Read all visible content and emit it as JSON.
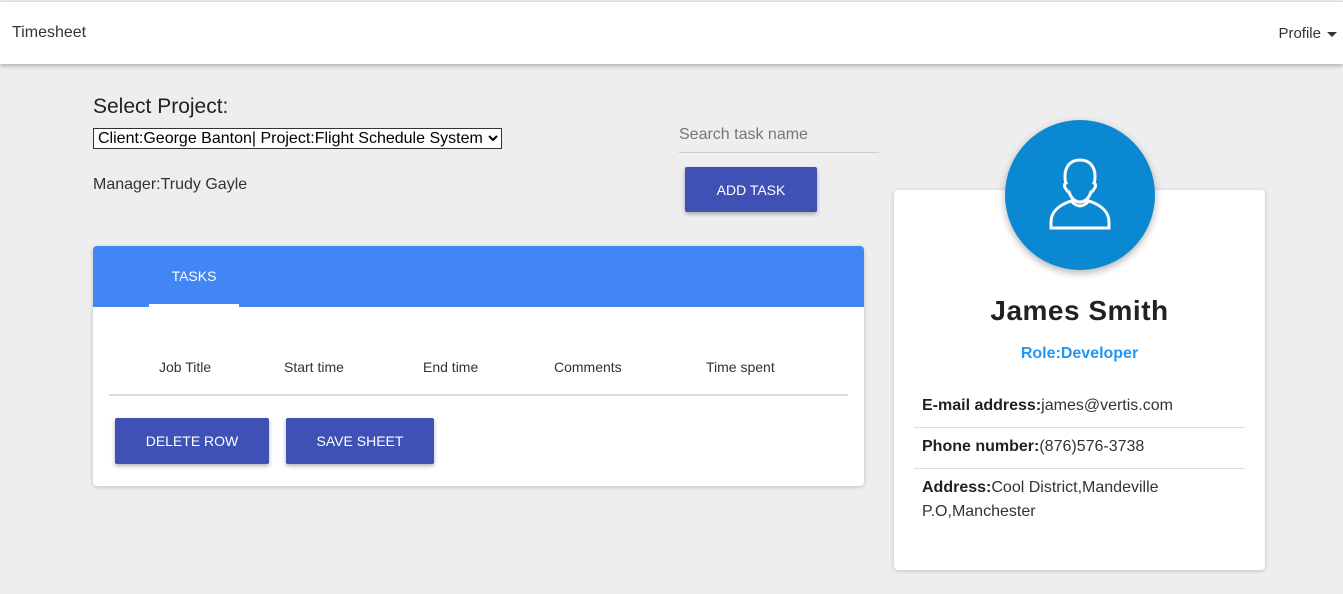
{
  "nav": {
    "brand": "Timesheet",
    "profile": "Profile"
  },
  "project": {
    "label": "Select Project:",
    "selected": "Client:George Banton| Project:Flight Schedule System",
    "manager": "Manager:Trudy Gayle"
  },
  "search": {
    "placeholder": "Search task name",
    "add_task": "ADD TASK"
  },
  "tasks": {
    "tab": "TASKS",
    "columns": [
      "Job Title",
      "Start time",
      "End time",
      "Comments",
      "Time spent"
    ],
    "delete_row": "DELETE ROW",
    "save_sheet": "SAVE SHEET"
  },
  "user": {
    "name": "James Smith",
    "role": "Role:Developer",
    "email_label": "E-mail address:",
    "email": "james@vertis.com",
    "phone_label": "Phone number:",
    "phone": "(876)576-3738",
    "address_label": "Address:",
    "address": "Cool District,Mandeville P.O,Manchester"
  }
}
